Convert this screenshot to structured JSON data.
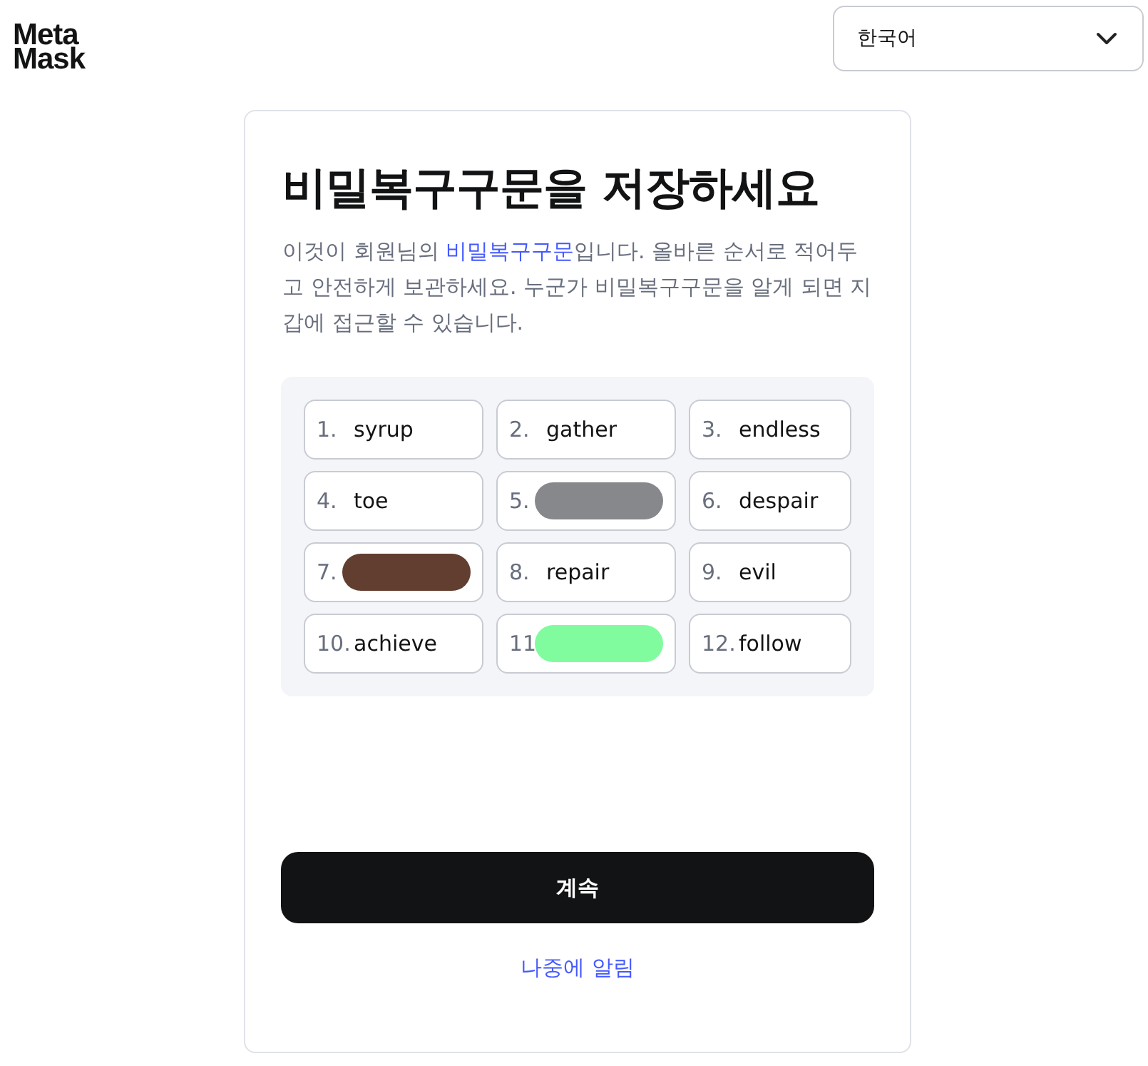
{
  "header": {
    "logo": [
      "Meta",
      "Mask"
    ],
    "language_select": {
      "value": "한국어"
    }
  },
  "card": {
    "title": "비밀복구구문을 저장하세요",
    "description": {
      "before": "이것이 회원님의 ",
      "link": "비밀복구구문",
      "after": "입니다. 올바른 순서로 적어두고 안전하게 보관하세요. 누군가 비밀복구구문을 알게 되면 지갑에 접근할 수 있습니다."
    },
    "words": [
      {
        "number": "1.",
        "kind": "word",
        "word": "syrup"
      },
      {
        "number": "2.",
        "kind": "word",
        "word": "gather"
      },
      {
        "number": "3.",
        "kind": "word",
        "word": "endless"
      },
      {
        "number": "4.",
        "kind": "word",
        "word": "toe"
      },
      {
        "number": "5.",
        "kind": "redacted",
        "color": "#87888b"
      },
      {
        "number": "6.",
        "kind": "word",
        "word": "despair"
      },
      {
        "number": "7.",
        "kind": "redacted",
        "color": "#613e2f"
      },
      {
        "number": "8.",
        "kind": "word",
        "word": "repair"
      },
      {
        "number": "9.",
        "kind": "word",
        "word": "evil"
      },
      {
        "number": "10.",
        "kind": "word",
        "word": "achieve"
      },
      {
        "number": "11",
        "kind": "redacted",
        "color": "#80fc9f"
      },
      {
        "number": "12.",
        "kind": "word",
        "word": "follow"
      }
    ],
    "continue_button": "계속",
    "remind_later_link": "나중에 알림"
  }
}
